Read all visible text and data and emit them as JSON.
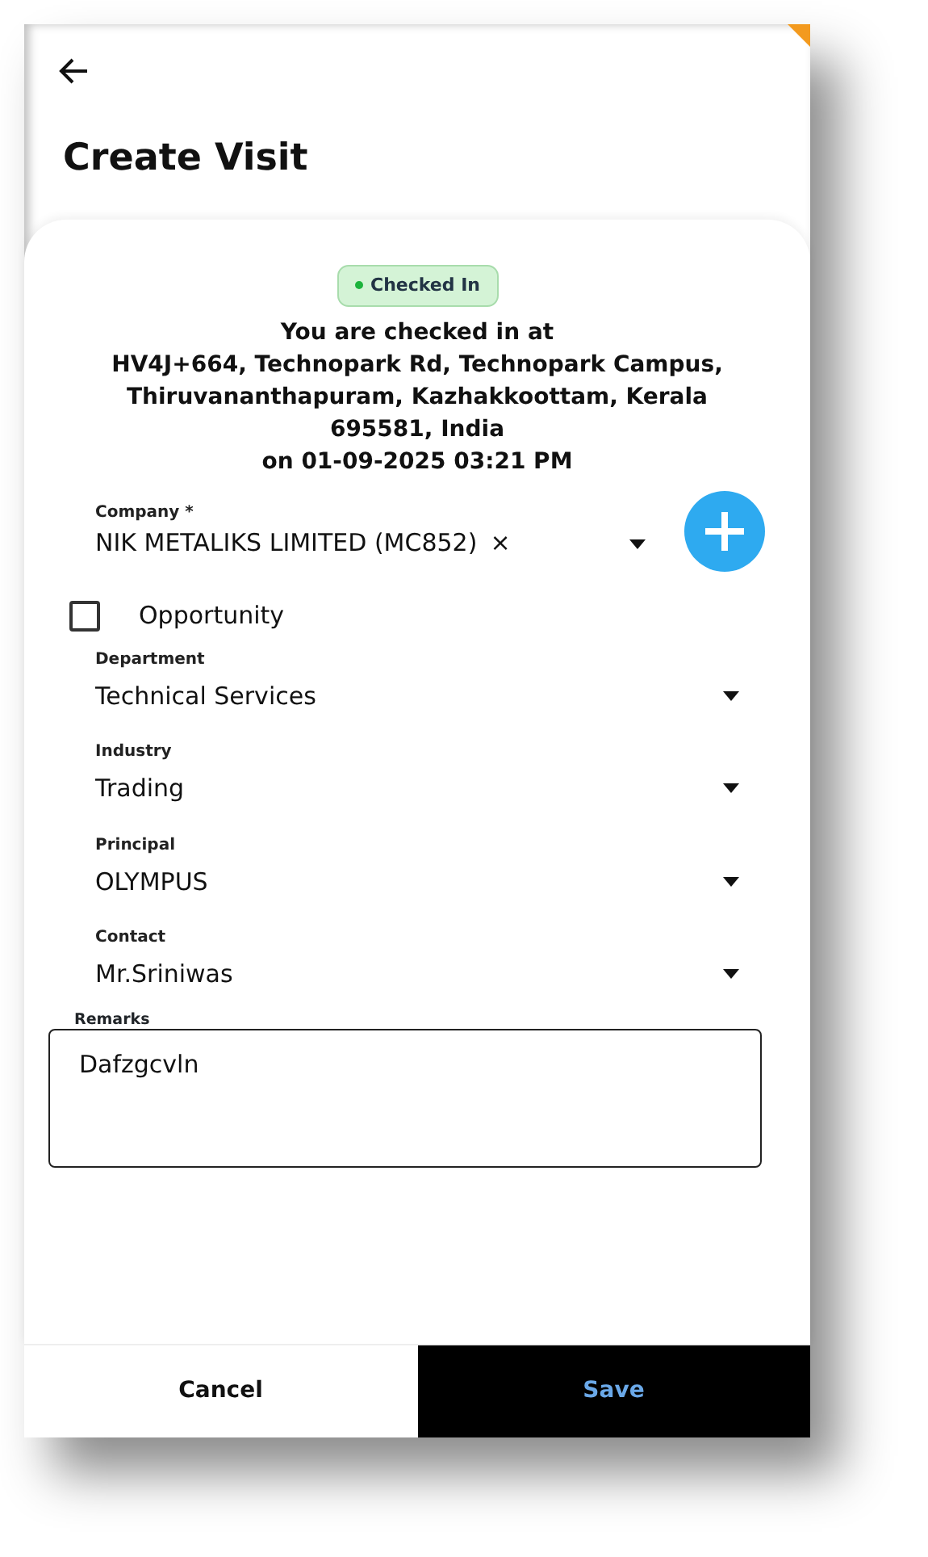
{
  "header": {
    "title": "Create Visit"
  },
  "checkin": {
    "status": "Checked In",
    "intro": "You are checked in at",
    "address": "HV4J+664, Technopark Rd, Technopark Campus, Thiruvananthapuram, Kazhakkoottam, Kerala 695581, India",
    "time": "on 01-09-2025 03:21 PM"
  },
  "company": {
    "label": "Company *",
    "value": "NIK METALIKS LIMITED (MC852)",
    "clear": "×"
  },
  "opportunity": {
    "label": "Opportunity",
    "checked": false
  },
  "selects": [
    {
      "label": "Department",
      "value": "Technical Services"
    },
    {
      "label": "Industry",
      "value": "Trading"
    },
    {
      "label": "Principal",
      "value": "OLYMPUS"
    },
    {
      "label": "Contact",
      "value": "Mr.Sriniwas"
    }
  ],
  "remarks": {
    "label": "Remarks",
    "value": "Dafzgcvln"
  },
  "buttons": [
    {
      "kind": "secondary",
      "label": "Cancel"
    },
    {
      "kind": "primary",
      "label": "Save"
    }
  ]
}
